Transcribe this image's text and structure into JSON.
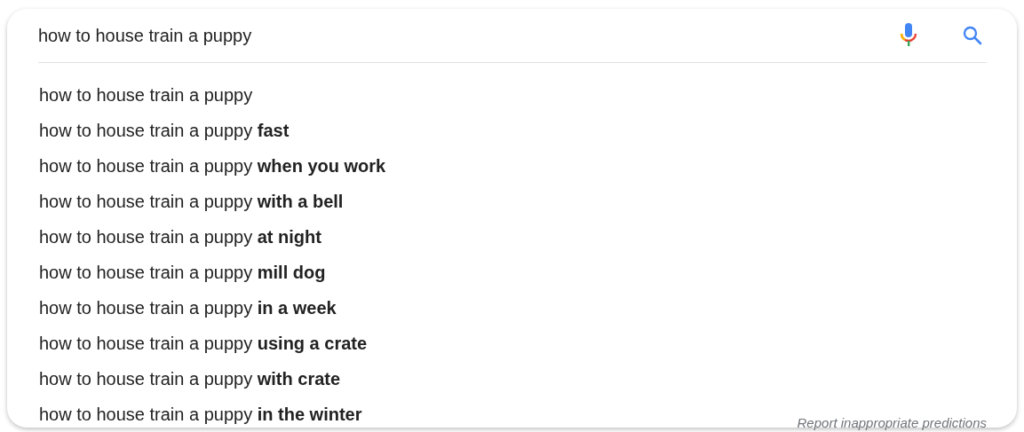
{
  "search": {
    "value": "how to house train a puppy"
  },
  "suggestions": [
    {
      "text": "how to house train a puppy"
    },
    {
      "text": "how to house train a puppy **fast**"
    },
    {
      "text": "how to house train a puppy **when you work**"
    },
    {
      "text": "how to house train a puppy **with a bell**"
    },
    {
      "text": "how to house train a puppy **at night**"
    },
    {
      "text": "how to house train a puppy **mill dog**"
    },
    {
      "text": "how to house train a puppy **in a week**"
    },
    {
      "text": "how to house train a puppy **using a crate**"
    },
    {
      "text": "how to house train a puppy **with crate**"
    },
    {
      "text": "how to house train a puppy **in the winter**"
    }
  ],
  "report_link": "Report inappropriate predictions"
}
